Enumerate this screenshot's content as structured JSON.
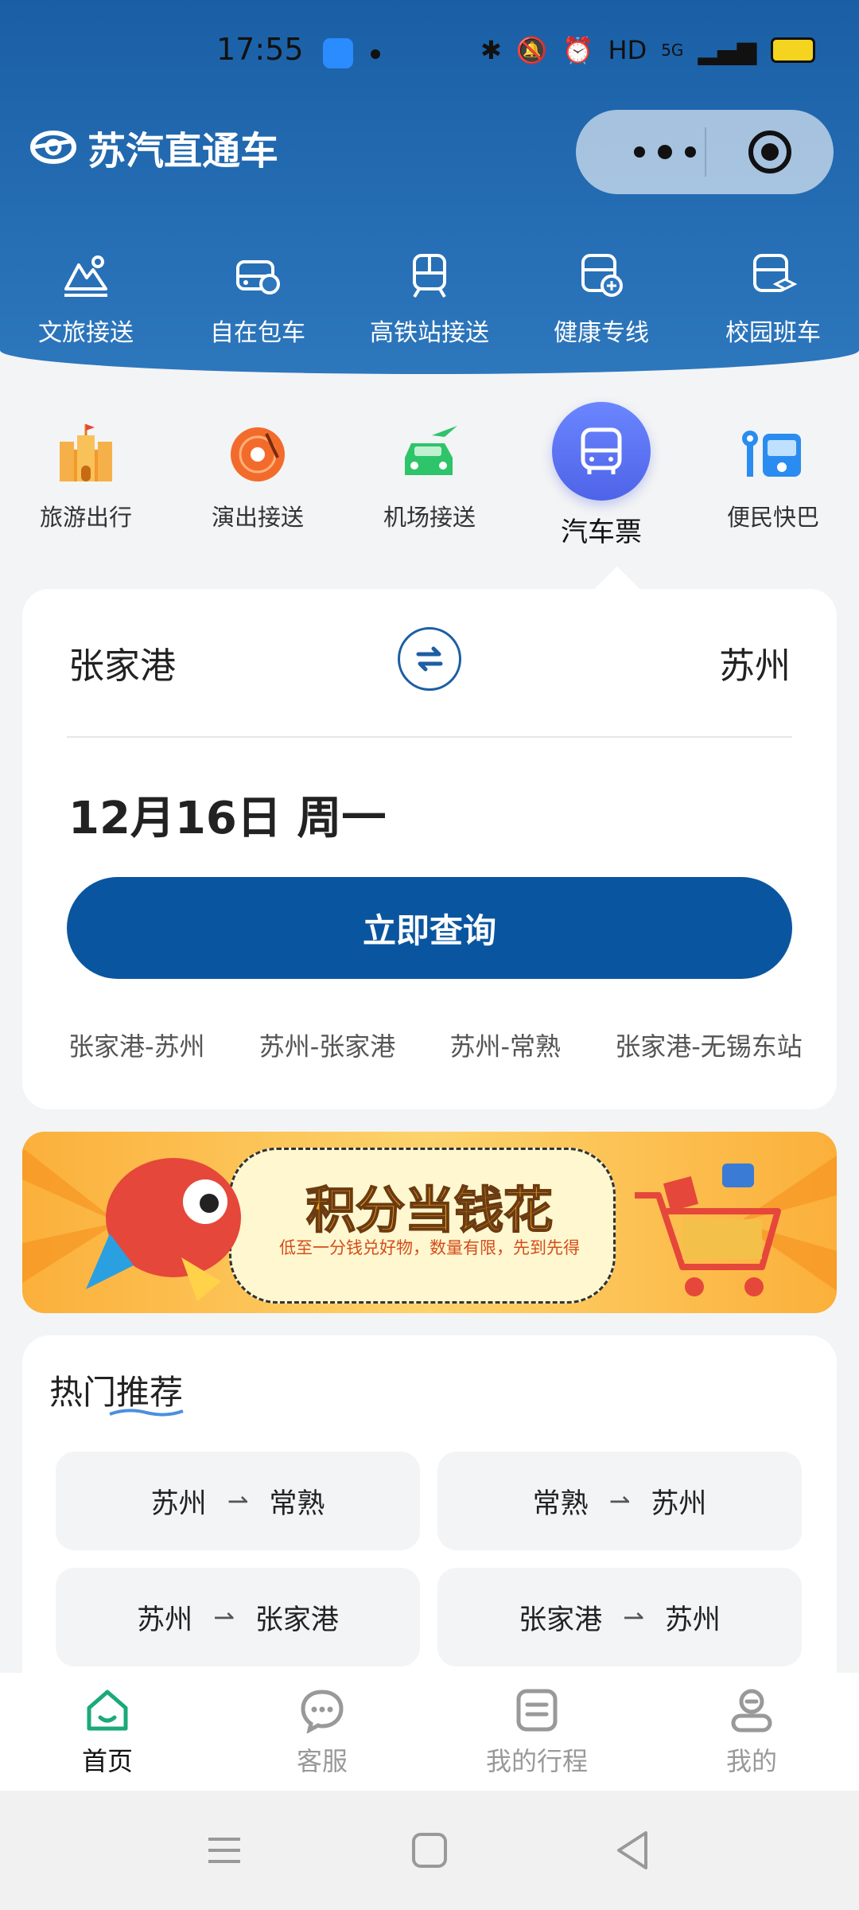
{
  "status_bar": {
    "time": "17:55",
    "hd": "HD",
    "network": "5G"
  },
  "app": {
    "title": "苏汽直通车"
  },
  "top_nav": [
    {
      "label": "文旅接送",
      "icon": "mountain-sun-icon"
    },
    {
      "label": "自在包车",
      "icon": "charter-car-icon"
    },
    {
      "label": "高铁站接送",
      "icon": "train-icon"
    },
    {
      "label": "健康专线",
      "icon": "health-bus-icon"
    },
    {
      "label": "校园班车",
      "icon": "campus-bus-icon"
    }
  ],
  "sub_nav": [
    {
      "label": "旅游出行",
      "icon": "castle-icon"
    },
    {
      "label": "演出接送",
      "icon": "record-icon"
    },
    {
      "label": "机场接送",
      "icon": "airport-car-icon"
    },
    {
      "label": "汽车票",
      "icon": "bus-icon",
      "active": true
    },
    {
      "label": "便民快巴",
      "icon": "bus-stop-icon"
    }
  ],
  "search": {
    "from": "张家港",
    "to": "苏州",
    "date": "12月16日 周一",
    "button": "立即查询",
    "history": [
      "张家港-苏州",
      "苏州-张家港",
      "苏州-常熟",
      "张家港-无锡东站"
    ]
  },
  "banner": {
    "title": "积分当钱花",
    "subtitle": "低至一分钱兑好物，数量有限，先到先得"
  },
  "hot": {
    "title": "热门推荐",
    "routes": [
      {
        "from": "苏州",
        "to": "常熟"
      },
      {
        "from": "常熟",
        "to": "苏州"
      },
      {
        "from": "苏州",
        "to": "张家港"
      },
      {
        "from": "张家港",
        "to": "苏州"
      }
    ]
  },
  "tabbar": [
    {
      "label": "首页",
      "icon": "home-icon",
      "active": true
    },
    {
      "label": "客服",
      "icon": "chat-icon"
    },
    {
      "label": "我的行程",
      "icon": "itinerary-icon"
    },
    {
      "label": "我的",
      "icon": "profile-icon"
    }
  ],
  "colors": {
    "primary": "#0a55a0",
    "header": "#1a5fa6",
    "active_tab": "#1aaa78",
    "banner": "#fbb03b"
  }
}
